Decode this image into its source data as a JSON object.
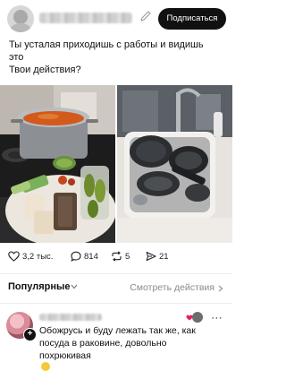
{
  "header": {
    "subscribe_label": "Подписаться"
  },
  "post": {
    "text_lines": [
      "Ты усталая приходишь с работы и видишь",
      "это",
      "Твои действия?"
    ]
  },
  "actions": {
    "likes": "3,2 тыс.",
    "comments": "814",
    "reposts": "5",
    "shares": "21"
  },
  "comments_section": {
    "sort_label": "Популярные",
    "see_actions_label": "Смотреть действия"
  },
  "comment": {
    "text_lines": [
      "Обожрусь и буду лежать так же, как",
      "посуда в раковине, довольно",
      "похрюкивая"
    ]
  },
  "colors": {
    "accent": "#111111",
    "heart_red": "#e0245e"
  }
}
